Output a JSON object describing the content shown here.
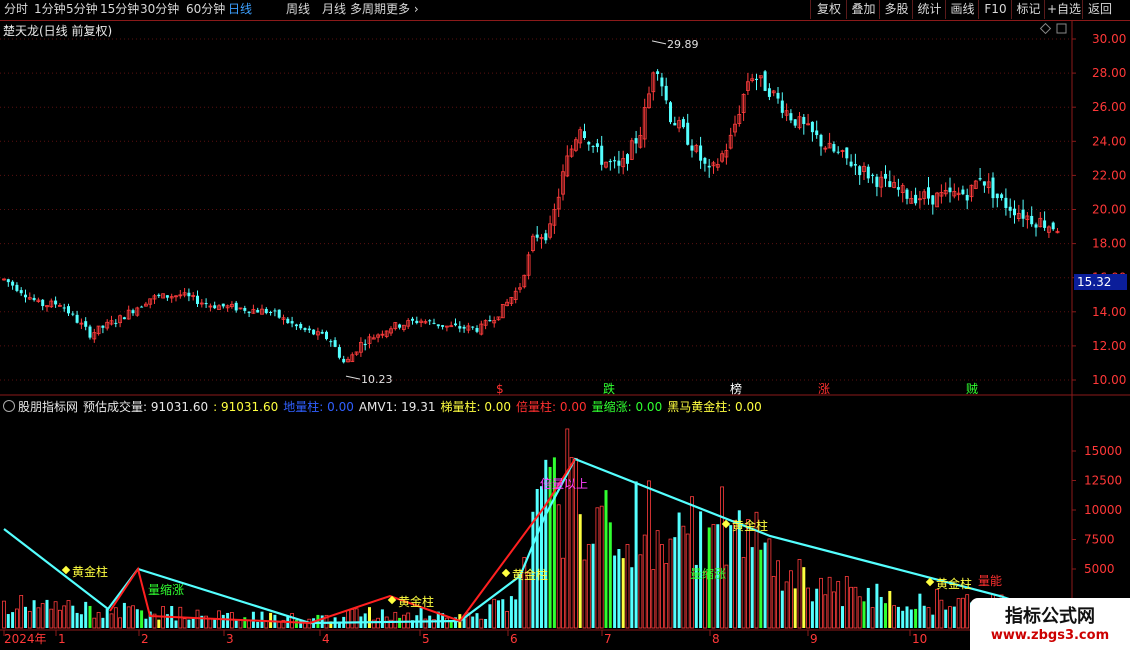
{
  "toolbar": {
    "timeframes": [
      "分时",
      "1分钟",
      "5分钟",
      "15分钟",
      "30分钟",
      "60分钟",
      "日线",
      "周线",
      "月线",
      "多周期",
      "更多"
    ],
    "active_index": 6,
    "right_buttons": [
      "复权",
      "叠加",
      "多股",
      "统计",
      "画线",
      "F10",
      "标记",
      "+自选",
      "返回"
    ]
  },
  "main_title": "楚天龙(日线 前复权)",
  "price_axis": [
    "30.00",
    "28.00",
    "26.00",
    "24.00",
    "22.00",
    "20.00",
    "18.00",
    "16.00",
    "14.00",
    "12.00",
    "10.00"
  ],
  "current_price": "15.32",
  "high_label": "29.89",
  "low_label": "10.23",
  "signal_labels": [
    {
      "text": "$",
      "color": "#ff3030"
    },
    {
      "text": "跌",
      "color": "#30ff30"
    },
    {
      "text": "榜",
      "color": "#ffffff"
    },
    {
      "text": "涨",
      "color": "#ff3030"
    },
    {
      "text": "贼",
      "color": "#30ff30"
    }
  ],
  "indicator": {
    "name": "股朋指标网",
    "items": [
      {
        "text": "预估成交量: 91031.60",
        "color": "#e8e8e8"
      },
      {
        "text": ": 91031.60",
        "color": "#ffff40"
      },
      {
        "text": "地量柱: 0.00",
        "color": "#3060ff"
      },
      {
        "text": "AMV1: 19.31",
        "color": "#e8e8e8"
      },
      {
        "text": "梯量柱: 0.00",
        "color": "#ffff40"
      },
      {
        "text": "倍量柱: 0.00",
        "color": "#ff3030"
      },
      {
        "text": "量缩涨: 0.00",
        "color": "#30ff30"
      },
      {
        "text": "黑马黄金柱: 0.00",
        "color": "#ffff40"
      }
    ],
    "axis": [
      "15000",
      "12500",
      "10000",
      "7500",
      "5000"
    ]
  },
  "volume_labels": [
    {
      "text": "黄金柱",
      "color": "#ffff40"
    },
    {
      "text": "量缩涨",
      "color": "#30ff30"
    },
    {
      "text": "黄金柱",
      "color": "#ffff40"
    },
    {
      "text": "黄金柱",
      "color": "#ffff40"
    },
    {
      "text": "倍量以上",
      "color": "#ff40ff"
    },
    {
      "text": "黄金柱",
      "color": "#ffff40"
    },
    {
      "text": "量缩涨",
      "color": "#30ff30"
    },
    {
      "text": "黄金柱",
      "color": "#ffff40"
    },
    {
      "text": "量能",
      "color": "#ff3030"
    }
  ],
  "date_axis": [
    "2024年",
    "1",
    "2",
    "3",
    "4",
    "5",
    "6",
    "7",
    "8",
    "9",
    "10"
  ],
  "watermark": {
    "line1": "指标公式网",
    "line2": "www.zbgs3.com"
  }
}
